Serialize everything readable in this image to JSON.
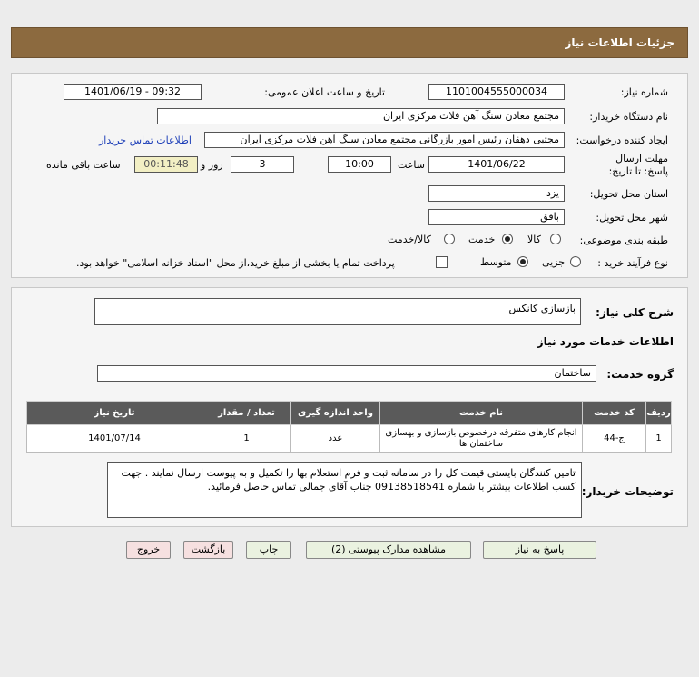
{
  "header": {
    "title": "جزئیات اطلاعات نیاز"
  },
  "form": {
    "need_number_label": "شماره نیاز:",
    "need_number": "1101004555000034",
    "announce_label": "تاریخ و ساعت اعلان عمومی:",
    "announce_value": "1401/06/19 - 09:32",
    "buyer_org_label": "نام دستگاه خریدار:",
    "buyer_org": "مجتمع معادن سنگ آهن فلات مرکزی ایران",
    "requester_label": "ایجاد کننده درخواست:",
    "requester": "مجتبی  دهقان رئیس امور بازرگانی مجتمع معادن سنگ آهن فلات مرکزی ایران",
    "contact_link": "اطلاعات تماس خریدار",
    "deadline_label": "مهلت ارسال پاسخ: تا تاریخ:",
    "deadline_date": "1401/06/22",
    "time_label": "ساعت",
    "deadline_time": "10:00",
    "days_value": "3",
    "days_label": "روز و",
    "remaining_time": "00:11:48",
    "remaining_label": "ساعت باقی مانده",
    "province_label": "استان محل تحویل:",
    "province": "یزد",
    "city_label": "شهر محل تحویل:",
    "city": "بافق",
    "category_label": "طبقه بندی موضوعی:",
    "category_options": [
      "کالا",
      "خدمت",
      "کالا/خدمت"
    ],
    "process_label": "نوع فرآیند خرید :",
    "process_options": [
      "جزیی",
      "متوسط"
    ],
    "payment_note": "پرداخت تمام یا بخشی از مبلغ خرید،از محل \"اسناد خزانه اسلامی\" خواهد بود."
  },
  "summary": {
    "label": "شرح کلی نیاز:",
    "value": "بازسازی کانکس",
    "services_title": "اطلاعات خدمات مورد نیاز",
    "service_group_label": "گروه خدمت:",
    "service_group": "ساختمان"
  },
  "table": {
    "headers": [
      "ردیف",
      "کد خدمت",
      "نام خدمت",
      "واحد اندازه گیری",
      "تعداد / مقدار",
      "تاریخ نیاز"
    ],
    "rows": [
      [
        "1",
        "ج-44",
        "انجام کارهای متفرقه درخصوص بازسازی و بهسازی ساختمان ها",
        "عدد",
        "1",
        "1401/07/14"
      ]
    ]
  },
  "description": {
    "label": "توضیحات خریدار:",
    "text": "تامین کنندگان بایستی قیمت کل را در سامانه ثبت و فرم استعلام بها را تکمیل و به پیوست ارسال نمایند . جهت کسب اطلاعات بیشتر با شماره 09138518541 جناب آقای جمالی تماس حاصل فرمائید."
  },
  "buttons": {
    "reply": "پاسخ به نیاز",
    "view_docs": "مشاهده مدارک پیوستی (2)",
    "print": "چاپ",
    "back": "بازگشت",
    "exit": "خروج"
  }
}
